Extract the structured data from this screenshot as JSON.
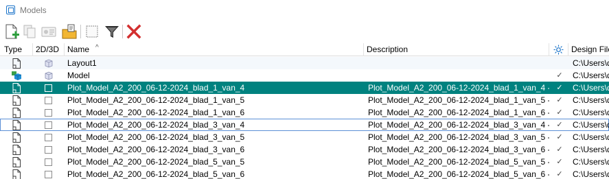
{
  "window": {
    "title": "Models"
  },
  "toolbar": {
    "buttons": [
      {
        "name": "new-model-button",
        "icon": "new-document-icon"
      },
      {
        "name": "copy-model-button",
        "icon": "copy-icon"
      },
      {
        "name": "properties-button",
        "icon": "properties-card-icon"
      },
      {
        "name": "import-button",
        "icon": "folder-import-icon"
      },
      {
        "name": "select-area-button",
        "icon": "dotted-rectangle-icon"
      },
      {
        "name": "filter-button",
        "icon": "funnel-icon"
      },
      {
        "name": "delete-button",
        "icon": "red-x-icon"
      }
    ]
  },
  "table": {
    "headers": {
      "type": "Type",
      "dim": "2D/3D",
      "name": "Name",
      "description": "Description",
      "file": "Design File"
    },
    "rows": [
      {
        "type": "doc",
        "dim": "3d",
        "name": "Layout1",
        "description": "",
        "check": "",
        "file": "C:\\Users\\d",
        "state": "alt"
      },
      {
        "type": "model",
        "dim": "3d",
        "name": "Model",
        "description": "",
        "check": "✓",
        "file": "C:\\Users\\d",
        "state": ""
      },
      {
        "type": "doc",
        "dim": "2d",
        "name": "Plot_Model_A2_200_06-12-2024_blad_1_van_4",
        "description": "Plot_Model_A2_200_06-12-2024_blad_1_van_4 -...",
        "check": "✓",
        "file": "C:\\Users\\d",
        "state": "sel"
      },
      {
        "type": "doc",
        "dim": "2d",
        "name": "Plot_Model_A2_200_06-12-2024_blad_1_van_5",
        "description": "Plot_Model_A2_200_06-12-2024_blad_1_van_5 -...",
        "check": "✓",
        "file": "C:\\Users\\d",
        "state": ""
      },
      {
        "type": "doc",
        "dim": "2d",
        "name": "Plot_Model_A2_200_06-12-2024_blad_1_van_6",
        "description": "Plot_Model_A2_200_06-12-2024_blad_1_van_6 -...",
        "check": "✓",
        "file": "C:\\Users\\d",
        "state": ""
      },
      {
        "type": "doc",
        "dim": "2d",
        "name": "Plot_Model_A2_200_06-12-2024_blad_3_van_4",
        "description": "Plot_Model_A2_200_06-12-2024_blad_3_van_4 -...",
        "check": "✓",
        "file": "C:\\Users\\d",
        "state": "focus"
      },
      {
        "type": "doc",
        "dim": "2d",
        "name": "Plot_Model_A2_200_06-12-2024_blad_3_van_5",
        "description": "Plot_Model_A2_200_06-12-2024_blad_3_van_5 -...",
        "check": "✓",
        "file": "C:\\Users\\d",
        "state": ""
      },
      {
        "type": "doc",
        "dim": "2d",
        "name": "Plot_Model_A2_200_06-12-2024_blad_3_van_6",
        "description": "Plot_Model_A2_200_06-12-2024_blad_3_van_6 -...",
        "check": "✓",
        "file": "C:\\Users\\d",
        "state": ""
      },
      {
        "type": "doc",
        "dim": "2d",
        "name": "Plot_Model_A2_200_06-12-2024_blad_5_van_5",
        "description": "Plot_Model_A2_200_06-12-2024_blad_5_van_5 -...",
        "check": "✓",
        "file": "C:\\Users\\d",
        "state": ""
      },
      {
        "type": "doc",
        "dim": "2d",
        "name": "Plot_Model_A2_200_06-12-2024_blad_5_van_6",
        "description": "Plot_Model_A2_200_06-12-2024_blad_5_van_6 -...",
        "check": "✓",
        "file": "C:\\Users\\d",
        "state": ""
      }
    ]
  },
  "colors": {
    "selection": "#00827f",
    "accent": "#1a73c9",
    "delete": "#d32f2f"
  }
}
